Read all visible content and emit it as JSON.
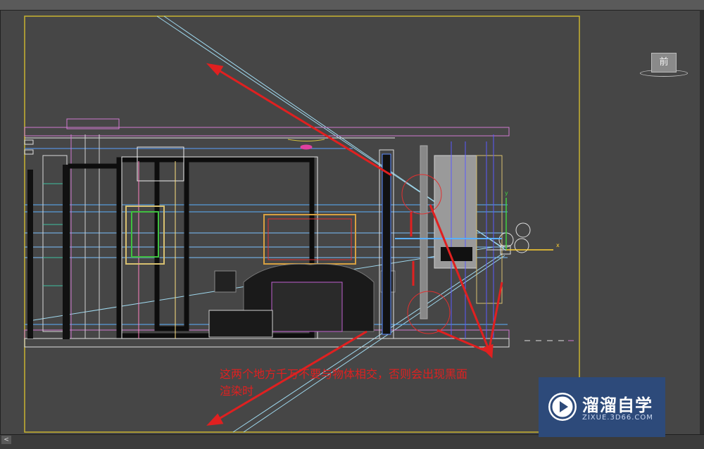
{
  "viewport": {
    "view_label": "前",
    "gizmo_x": "x",
    "gizmo_y": "y"
  },
  "annotation": {
    "line1": "这两个地方千万不要与物体相交，否则会出现黑面",
    "line2": "渲染时"
  },
  "watermark": {
    "name": "溜溜自学",
    "url": "ZIXUE.3D66.COM"
  },
  "colors": {
    "viewport_bg": "#464646",
    "safe_frame": "#c8b430",
    "arrow": "#e02020",
    "logo_bg": "#2d4a7a"
  },
  "icons": [
    "view-cube-icon",
    "transform-gizmo-icon",
    "play-logo-icon"
  ]
}
